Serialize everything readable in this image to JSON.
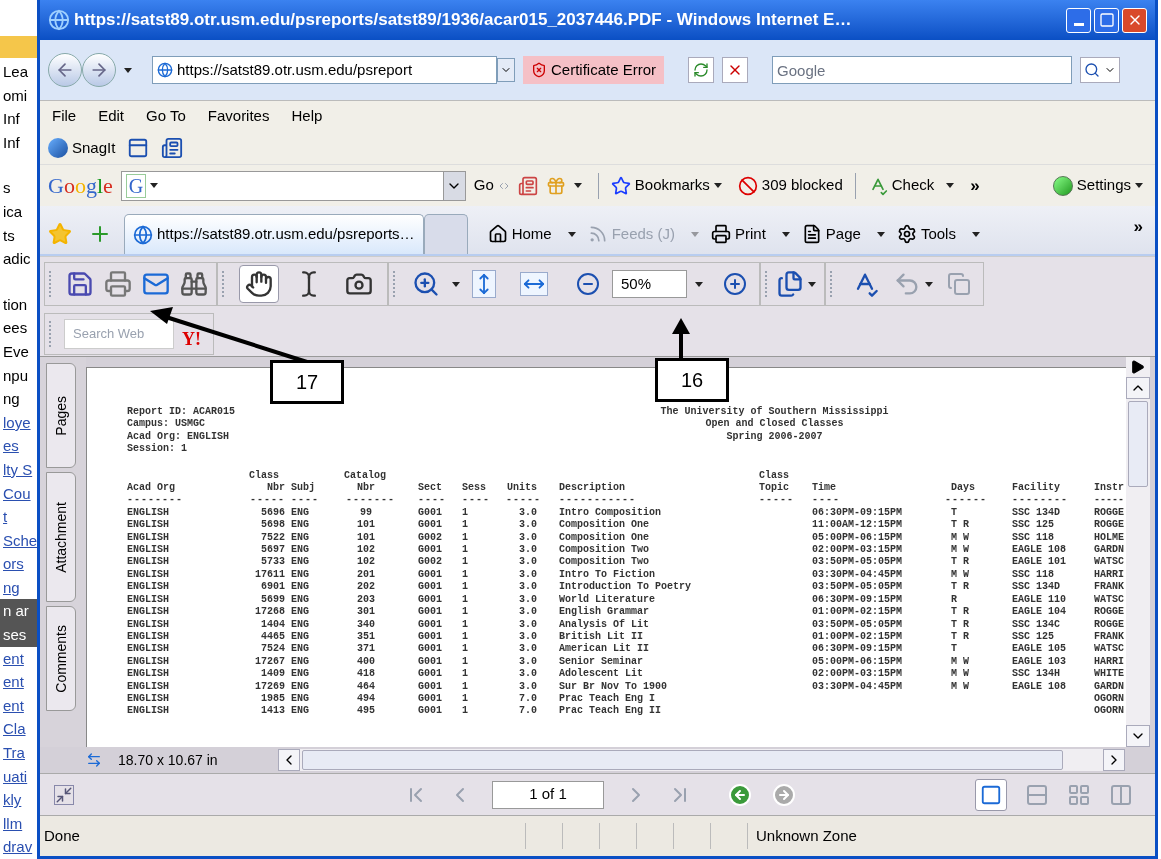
{
  "background_window": {
    "fragment_groups": [
      [
        {
          "text": "Lea",
          "kind": "plain"
        },
        {
          "text": "omi",
          "kind": "plain"
        },
        {
          "text": "Inf",
          "kind": "plain"
        },
        {
          "text": "Inf",
          "kind": "plain"
        }
      ],
      [
        {
          "text": "s",
          "kind": "plain"
        },
        {
          "text": "ica",
          "kind": "plain"
        },
        {
          "text": "ts",
          "kind": "plain"
        },
        {
          "text": "adic",
          "kind": "plain"
        }
      ],
      [
        {
          "text": "tion",
          "kind": "plain"
        },
        {
          "text": "ees",
          "kind": "plain"
        },
        {
          "text": "Eve",
          "kind": "plain"
        },
        {
          "text": "npu",
          "kind": "plain"
        },
        {
          "text": "ng",
          "kind": "plain"
        },
        {
          "text": "loye",
          "kind": "link"
        },
        {
          "text": "es",
          "kind": "link"
        },
        {
          "text": "lty S",
          "kind": "link"
        },
        {
          "text": "Cou",
          "kind": "link"
        },
        {
          "text": "t",
          "kind": "link"
        },
        {
          "text": "Sche",
          "kind": "link"
        },
        {
          "text": "ors",
          "kind": "link"
        },
        {
          "text": "ng",
          "kind": "link"
        },
        {
          "text": "n ar",
          "kind": "highlight"
        },
        {
          "text": "ses",
          "kind": "highlight"
        },
        {
          "text": "ent",
          "kind": "link"
        },
        {
          "text": "ent",
          "kind": "link"
        },
        {
          "text": "ent",
          "kind": "link"
        },
        {
          "text": "Cla",
          "kind": "link"
        },
        {
          "text": "Tra",
          "kind": "link"
        },
        {
          "text": "uati",
          "kind": "link"
        },
        {
          "text": "kly",
          "kind": "link"
        },
        {
          "text": "llm",
          "kind": "link"
        },
        {
          "text": "drav",
          "kind": "link"
        }
      ]
    ]
  },
  "window": {
    "title": "https://satst89.otr.usm.edu/psreports/satst89/1936/acar015_2037446.PDF - Windows Internet E…"
  },
  "address_bar": {
    "url": "https://satst89.otr.usm.edu/psreport",
    "certificate": "Certificate Error",
    "search_placeholder": "Google"
  },
  "menu": [
    "File",
    "Edit",
    "Go To",
    "Favorites",
    "Help"
  ],
  "links_toolbar": {
    "snagit": "SnagIt"
  },
  "google_toolbar": {
    "logo": "Google",
    "search_logo": "G",
    "go": "Go",
    "bookmarks": "Bookmarks",
    "blocked": "309 blocked",
    "check": "Check",
    "more": "»",
    "settings": "Settings"
  },
  "tabs": [
    {
      "label": "https://satst89.otr.usm.edu/psreports…",
      "selected": true
    },
    {
      "selected": false
    }
  ],
  "command_bar": {
    "items": [
      {
        "kind": "home",
        "label": "Home",
        "disabled": false
      },
      {
        "kind": "feeds",
        "label": "Feeds (J)",
        "disabled": true
      },
      {
        "kind": "print",
        "label": "Print",
        "disabled": false
      },
      {
        "kind": "page",
        "label": "Page",
        "disabled": false
      },
      {
        "kind": "tools",
        "label": "Tools",
        "disabled": false
      }
    ],
    "more": "»"
  },
  "pdf_toolbar": {
    "tools": [
      {
        "kind": "hand",
        "selected": true
      },
      {
        "kind": "select",
        "selected": false
      },
      {
        "kind": "snapshot",
        "selected": false
      }
    ],
    "zoom": "50%"
  },
  "search_web": {
    "placeholder": "Search Web",
    "logo": "Y!"
  },
  "side_tabs": [
    {
      "label": "Pages"
    },
    {
      "label": "Attachment"
    },
    {
      "label": "Comments"
    }
  ],
  "report": {
    "header_left": [
      "Report ID: ACAR015",
      "Campus: USMGC",
      "Acad Org: ENGLISH",
      "Session: 1"
    ],
    "header_center": [
      "The University of Southern Mississippi",
      "Open and Closed Classes",
      "Spring 2006-2007"
    ],
    "columns": [
      {
        "label": "Acad Org",
        "rule": "--------"
      },
      {
        "top": "Class",
        "label": "Nbr",
        "rule": "-----"
      },
      {
        "label": "Subj",
        "rule": "----"
      },
      {
        "top": "Catalog",
        "label": "Nbr",
        "rule": "-------"
      },
      {
        "label": "Sect",
        "rule": "----"
      },
      {
        "label": "Sess",
        "rule": "----"
      },
      {
        "label": "Units",
        "rule": "-----"
      },
      {
        "label": "Description",
        "rule": "-----------"
      },
      {
        "top": "Class",
        "label": "Topic",
        "rule": "-----"
      },
      {
        "label": "Time",
        "rule": "----"
      },
      {
        "label": "Days",
        "rule": "------"
      },
      {
        "label": "Facility",
        "rule": "--------"
      },
      {
        "label": "Instr",
        "rule": "-----"
      }
    ],
    "rows": [
      {
        "acad_org": "ENGLISH",
        "class_nbr": "5696",
        "subj": "ENG",
        "catalog_nbr": "99",
        "sect": "G001",
        "sess": "1",
        "units": "3.0",
        "description": "Intro Composition",
        "time": "06:30PM-09:15PM",
        "days": "T",
        "facility": "SSC 134D",
        "instr": "ROGGE"
      },
      {
        "acad_org": "ENGLISH",
        "class_nbr": "5698",
        "subj": "ENG",
        "catalog_nbr": "101",
        "sect": "G001",
        "sess": "1",
        "units": "3.0",
        "description": "Composition One",
        "time": "11:00AM-12:15PM",
        "days": "T R",
        "facility": "SSC 125",
        "instr": "ROGGE"
      },
      {
        "acad_org": "ENGLISH",
        "class_nbr": "7522",
        "subj": "ENG",
        "catalog_nbr": "101",
        "sect": "G002",
        "sess": "1",
        "units": "3.0",
        "description": "Composition One",
        "time": "05:00PM-06:15PM",
        "days": "M W",
        "facility": "SSC 118",
        "instr": "HOLME"
      },
      {
        "acad_org": "ENGLISH",
        "class_nbr": "5697",
        "subj": "ENG",
        "catalog_nbr": "102",
        "sect": "G001",
        "sess": "1",
        "units": "3.0",
        "description": "Composition Two",
        "time": "02:00PM-03:15PM",
        "days": "M W",
        "facility": "EAGLE 108",
        "instr": "GARDN"
      },
      {
        "acad_org": "ENGLISH",
        "class_nbr": "5733",
        "subj": "ENG",
        "catalog_nbr": "102",
        "sect": "G002",
        "sess": "1",
        "units": "3.0",
        "description": "Composition Two",
        "time": "03:50PM-05:05PM",
        "days": "T R",
        "facility": "EAGLE 101",
        "instr": "WATSC"
      },
      {
        "acad_org": "ENGLISH",
        "class_nbr": "17611",
        "subj": "ENG",
        "catalog_nbr": "201",
        "sect": "G001",
        "sess": "1",
        "units": "3.0",
        "description": "Intro To Fiction",
        "time": "03:30PM-04:45PM",
        "days": "M W",
        "facility": "SSC 118",
        "instr": "HARRI"
      },
      {
        "acad_org": "ENGLISH",
        "class_nbr": "6901",
        "subj": "ENG",
        "catalog_nbr": "202",
        "sect": "G001",
        "sess": "1",
        "units": "3.0",
        "description": "Introduction To Poetry",
        "time": "03:50PM-05:05PM",
        "days": "T R",
        "facility": "SSC 134D",
        "instr": "FRANK"
      },
      {
        "acad_org": "ENGLISH",
        "class_nbr": "5699",
        "subj": "ENG",
        "catalog_nbr": "203",
        "sect": "G001",
        "sess": "1",
        "units": "3.0",
        "description": "World Literature",
        "time": "06:30PM-09:15PM",
        "days": "R",
        "facility": "EAGLE 110",
        "instr": "WATSC"
      },
      {
        "acad_org": "ENGLISH",
        "class_nbr": "17268",
        "subj": "ENG",
        "catalog_nbr": "301",
        "sect": "G001",
        "sess": "1",
        "units": "3.0",
        "description": "English Grammar",
        "time": "01:00PM-02:15PM",
        "days": "T R",
        "facility": "EAGLE 104",
        "instr": "ROGGE"
      },
      {
        "acad_org": "ENGLISH",
        "class_nbr": "1404",
        "subj": "ENG",
        "catalog_nbr": "340",
        "sect": "G001",
        "sess": "1",
        "units": "3.0",
        "description": "Analysis Of Lit",
        "time": "03:50PM-05:05PM",
        "days": "T R",
        "facility": "SSC 134C",
        "instr": "ROGGE"
      },
      {
        "acad_org": "ENGLISH",
        "class_nbr": "4465",
        "subj": "ENG",
        "catalog_nbr": "351",
        "sect": "G001",
        "sess": "1",
        "units": "3.0",
        "description": "British Lit II",
        "time": "01:00PM-02:15PM",
        "days": "T R",
        "facility": "SSC 125",
        "instr": "FRANK"
      },
      {
        "acad_org": "ENGLISH",
        "class_nbr": "7524",
        "subj": "ENG",
        "catalog_nbr": "371",
        "sect": "G001",
        "sess": "1",
        "units": "3.0",
        "description": "American Lit II",
        "time": "06:30PM-09:15PM",
        "days": "T",
        "facility": "EAGLE 105",
        "instr": "WATSC"
      },
      {
        "acad_org": "ENGLISH",
        "class_nbr": "17267",
        "subj": "ENG",
        "catalog_nbr": "400",
        "sect": "G001",
        "sess": "1",
        "units": "3.0",
        "description": "Senior Seminar",
        "time": "05:00PM-06:15PM",
        "days": "M W",
        "facility": "EAGLE 103",
        "instr": "HARRI"
      },
      {
        "acad_org": "ENGLISH",
        "class_nbr": "1409",
        "subj": "ENG",
        "catalog_nbr": "418",
        "sect": "G001",
        "sess": "1",
        "units": "3.0",
        "description": "Adolescent Lit",
        "time": "02:00PM-03:15PM",
        "days": "M W",
        "facility": "SSC 134H",
        "instr": "WHITE"
      },
      {
        "acad_org": "ENGLISH",
        "class_nbr": "17269",
        "subj": "ENG",
        "catalog_nbr": "464",
        "sect": "G001",
        "sess": "1",
        "units": "3.0",
        "description": "Sur Br Nov To 1900",
        "time": "03:30PM-04:45PM",
        "days": "M W",
        "facility": "EAGLE 108",
        "instr": "GARDN"
      },
      {
        "acad_org": "ENGLISH",
        "class_nbr": "1985",
        "subj": "ENG",
        "catalog_nbr": "494",
        "sect": "G001",
        "sess": "1",
        "units": "7.0",
        "description": "Prac Teach Eng I",
        "instr": "OGORN"
      },
      {
        "acad_org": "ENGLISH",
        "class_nbr": "1413",
        "subj": "ENG",
        "catalog_nbr": "495",
        "sect": "G001",
        "sess": "1",
        "units": "7.0",
        "description": "Prac Teach Eng II",
        "instr": "OGORN"
      }
    ]
  },
  "page_size": "18.70 x 10.67 in",
  "navigation": {
    "page": "1 of 1"
  },
  "status_bar": {
    "text": "Done",
    "zone": "Unknown Zone"
  },
  "callouts": [
    {
      "label": "17"
    },
    {
      "label": "16"
    }
  ]
}
